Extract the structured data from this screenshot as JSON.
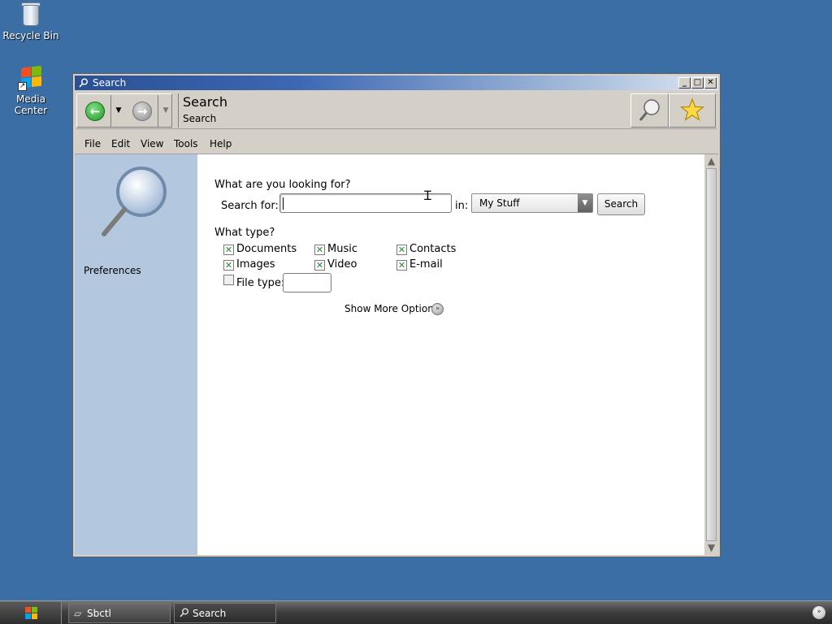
{
  "desktop": {
    "icons": [
      {
        "label": "Recycle Bin"
      },
      {
        "label": "Media Center"
      }
    ]
  },
  "window": {
    "title": "Search",
    "controls": {
      "minimize": "_",
      "maximize": "□",
      "close": "✕"
    },
    "toolbar": {
      "back_icon": "←",
      "forward_icon": "→",
      "dropdown_icon": "▼",
      "address_title": "Search",
      "address_sub": "Search"
    },
    "menu": [
      "File",
      "Edit",
      "View",
      "Tools",
      "Help"
    ],
    "sidebar": {
      "link": "Preferences"
    },
    "form": {
      "question": "What are you looking for?",
      "search_for_label": "Search for:",
      "search_value": "",
      "in_label": "in:",
      "location": "My Stuff",
      "search_button": "Search",
      "type_question": "What type?",
      "types": [
        {
          "label": "Documents",
          "checked": true
        },
        {
          "label": "Music",
          "checked": true
        },
        {
          "label": "Contacts",
          "checked": true
        },
        {
          "label": "Images",
          "checked": true
        },
        {
          "label": "Video",
          "checked": true
        },
        {
          "label": "E-mail",
          "checked": true
        }
      ],
      "file_type_label": "File type:",
      "file_type_value": "",
      "file_type_checked": false,
      "more_options": "Show More Options"
    }
  },
  "taskbar": {
    "items": [
      {
        "label": "Sbctl",
        "active": false
      },
      {
        "label": "Search",
        "active": true
      }
    ]
  },
  "colors": {
    "desktop": "#3b6ea5",
    "sidebar": "#b3c7df",
    "check": "#2a8a2a"
  }
}
